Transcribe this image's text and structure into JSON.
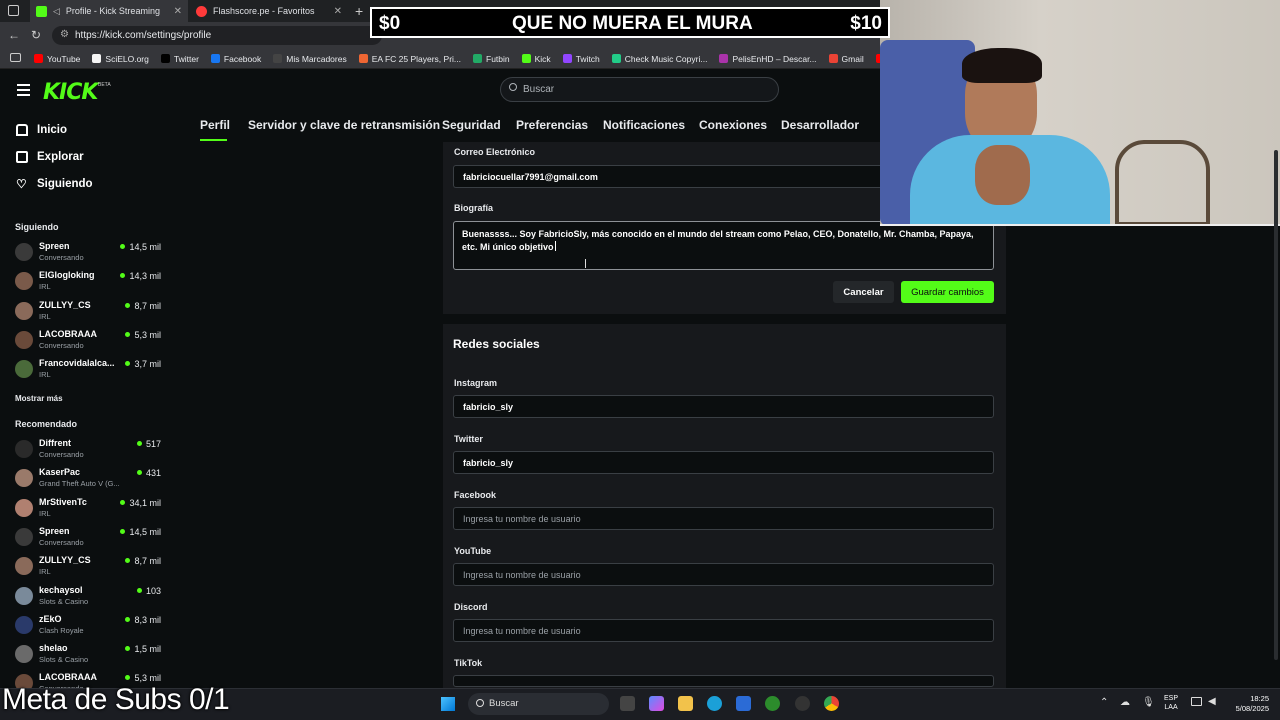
{
  "browser": {
    "tabs": [
      {
        "label": "Profile - Kick Streaming"
      },
      {
        "label": "Flashscore.pe - Favoritos"
      }
    ],
    "url": "https://kick.com/settings/profile",
    "bookmarks": [
      "YouTube",
      "SciELO.org",
      "Twitter",
      "Facebook",
      "Mis Marcadores",
      "EA FC 25 Players, Pri...",
      "Futbin",
      "Kick",
      "Twitch",
      "Check Music Copyri...",
      "PelisEnHD – Descar...",
      "Gmail",
      "YouTube"
    ]
  },
  "overlay": {
    "banner_left": "$0",
    "banner_center": "QUE NO MUERA EL MURA",
    "banner_right": "$10",
    "meta_text": "Meta de Subs 0/1"
  },
  "header": {
    "logo": "KICK",
    "logo_badge": "BETA",
    "search_placeholder": "Buscar",
    "tabs": [
      "Perfil",
      "Servidor y clave de retransmisión",
      "Seguridad",
      "Preferencias",
      "Notificaciones",
      "Conexiones",
      "Desarrollador"
    ]
  },
  "sidebar": {
    "nav": [
      "Inicio",
      "Explorar",
      "Siguiendo"
    ],
    "following_title": "Siguiendo",
    "following": [
      {
        "name": "Spreen",
        "category": "Conversando",
        "viewers": "14,5 mil"
      },
      {
        "name": "ElGlogloking",
        "category": "IRL",
        "viewers": "14,3 mil"
      },
      {
        "name": "ZULLYY_CS",
        "category": "IRL",
        "viewers": "8,7 mil"
      },
      {
        "name": "LACOBRAAA",
        "category": "Conversando",
        "viewers": "5,3 mil"
      },
      {
        "name": "Francovidalalca...",
        "category": "IRL",
        "viewers": "3,7 mil"
      }
    ],
    "show_more": "Mostrar más",
    "recommended_title": "Recomendado",
    "recommended": [
      {
        "name": "Diffrent",
        "category": "Conversando",
        "viewers": "517"
      },
      {
        "name": "KaserPac",
        "category": "Grand Theft Auto V (G...",
        "viewers": "431"
      },
      {
        "name": "MrStivenTc",
        "category": "IRL",
        "viewers": "34,1 mil"
      },
      {
        "name": "Spreen",
        "category": "Conversando",
        "viewers": "14,5 mil"
      },
      {
        "name": "ZULLYY_CS",
        "category": "IRL",
        "viewers": "8,7 mil"
      },
      {
        "name": "kechaysol",
        "category": "Slots & Casino",
        "viewers": "103"
      },
      {
        "name": "zEkO",
        "category": "Clash Royale",
        "viewers": "8,3 mil"
      },
      {
        "name": "shelao",
        "category": "Slots & Casino",
        "viewers": "1,5 mil"
      },
      {
        "name": "LACOBRAAA",
        "category": "Conversando",
        "viewers": "5,3 mil"
      }
    ]
  },
  "profile": {
    "email_label": "Correo Electrónico",
    "email_value": "fabriciocuellar7991@gmail.com",
    "bio_label": "Biografía",
    "bio_value": "Buenassss... Soy FabricioSly, más conocido en el mundo del stream como Pelao, CEO, Donatello, Mr. Chamba, Papaya, etc. Mi único objetivo",
    "cancel": "Cancelar",
    "save": "Guardar cambios"
  },
  "social": {
    "title": "Redes sociales",
    "fields": [
      {
        "label": "Instagram",
        "value": "fabricio_sly",
        "placeholder": ""
      },
      {
        "label": "Twitter",
        "value": "fabricio_sly",
        "placeholder": ""
      },
      {
        "label": "Facebook",
        "value": "",
        "placeholder": "Ingresa tu nombre de usuario"
      },
      {
        "label": "YouTube",
        "value": "",
        "placeholder": "Ingresa tu nombre de usuario"
      },
      {
        "label": "Discord",
        "value": "",
        "placeholder": "Ingresa tu nombre de usuario"
      },
      {
        "label": "TikTok",
        "value": "",
        "placeholder": ""
      }
    ]
  },
  "taskbar": {
    "search": "Buscar",
    "lang_top": "ESP",
    "lang_bottom": "LAA",
    "time": "18:25",
    "date": "5/08/2025"
  },
  "colors": {
    "accent": "#53fc18",
    "background": "#0b0e0f",
    "panel": "#17191c"
  }
}
